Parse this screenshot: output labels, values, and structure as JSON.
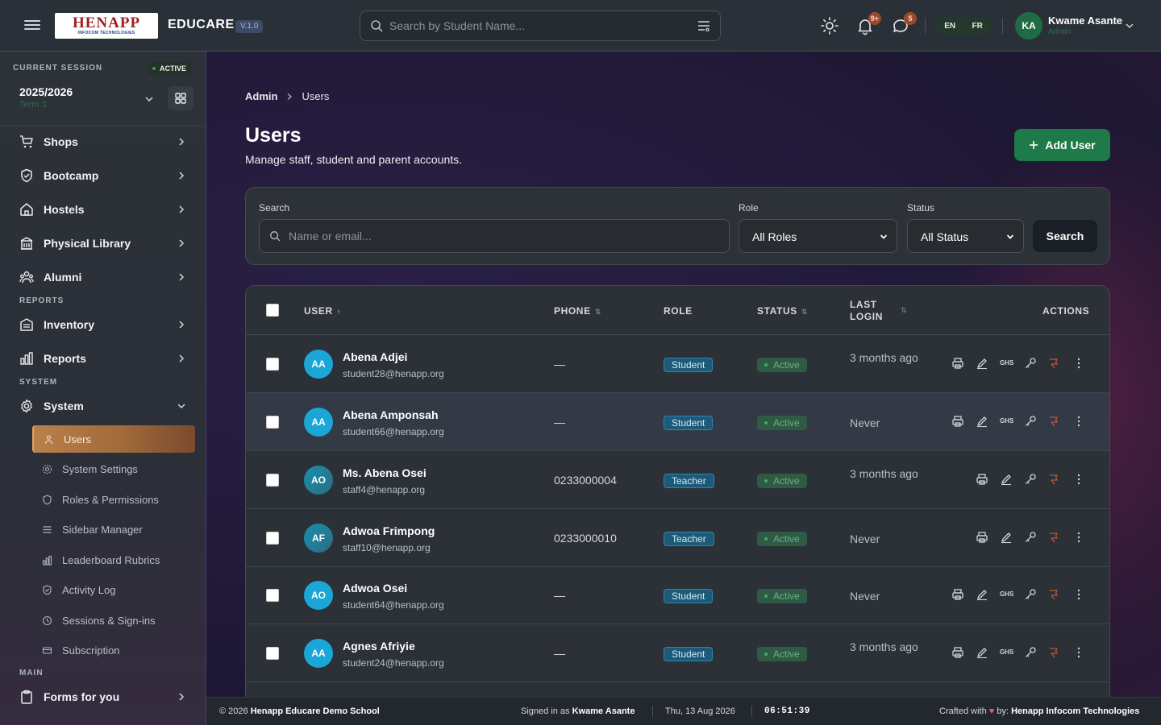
{
  "header": {
    "logo_text": "HENAPP",
    "logo_subtext": "INFOCOM TECHNOLOGIES",
    "app_name": "EDUCARE",
    "version": "V.1.0",
    "search_placeholder": "Search by Student Name...",
    "notifications_count": "9+",
    "messages_count": "5",
    "lang_en": "EN",
    "lang_fr": "FR",
    "user_initials": "KA",
    "user_name": "Kwame Asante",
    "user_role": "Admin"
  },
  "sidebar": {
    "session_label": "CURRENT SESSION",
    "session_status": "ACTIVE",
    "session_year": "2025/2026",
    "session_term": "Term 3",
    "items": [
      {
        "label": "Shops"
      },
      {
        "label": "Bootcamp"
      },
      {
        "label": "Hostels"
      },
      {
        "label": "Physical Library"
      },
      {
        "label": "Alumni"
      }
    ],
    "section_reports": "REPORTS",
    "reports_items": [
      {
        "label": "Inventory"
      },
      {
        "label": "Reports"
      }
    ],
    "section_system": "SYSTEM",
    "system_label": "System",
    "system_sub": [
      {
        "label": "Users"
      },
      {
        "label": "System Settings"
      },
      {
        "label": "Roles & Permissions"
      },
      {
        "label": "Sidebar Manager"
      },
      {
        "label": "Leaderboard Rubrics"
      },
      {
        "label": "Activity Log"
      },
      {
        "label": "Sessions & Sign-ins"
      },
      {
        "label": "Subscription"
      }
    ],
    "section_main": "MAIN",
    "main_items": [
      {
        "label": "Forms for you"
      }
    ]
  },
  "page": {
    "breadcrumb_root": "Admin",
    "breadcrumb_current": "Users",
    "title": "Users",
    "subtitle": "Manage staff, student and parent accounts.",
    "add_button": "Add User"
  },
  "filters": {
    "search_label": "Search",
    "search_placeholder": "Name or email...",
    "role_label": "Role",
    "role_value": "All Roles",
    "status_label": "Status",
    "status_value": "All Status",
    "search_button": "Search"
  },
  "table": {
    "headers": {
      "user": "USER",
      "phone": "PHONE",
      "role": "ROLE",
      "status": "STATUS",
      "last_login_1": "LAST",
      "last_login_2": "LOGIN",
      "actions": "ACTIONS"
    },
    "rows": [
      {
        "initials": "AA",
        "name": "Abena Adjei",
        "email": "student28@henapp.org",
        "phone": "—",
        "role": "Student",
        "status": "Active",
        "last_login": "3 months ago"
      },
      {
        "initials": "AA",
        "name": "Abena Amponsah",
        "email": "student66@henapp.org",
        "phone": "—",
        "role": "Student",
        "status": "Active",
        "last_login": "Never"
      },
      {
        "initials": "AO",
        "name": "Ms. Abena Osei",
        "email": "staff4@henapp.org",
        "phone": "0233000004",
        "role": "Teacher",
        "status": "Active",
        "last_login": "3 months ago"
      },
      {
        "initials": "AF",
        "name": "Adwoa Frimpong",
        "email": "staff10@henapp.org",
        "phone": "0233000010",
        "role": "Teacher",
        "status": "Active",
        "last_login": "Never"
      },
      {
        "initials": "AO",
        "name": "Adwoa Osei",
        "email": "student64@henapp.org",
        "phone": "—",
        "role": "Student",
        "status": "Active",
        "last_login": "Never"
      },
      {
        "initials": "AA",
        "name": "Agnes Afriyie",
        "email": "student24@henapp.org",
        "phone": "—",
        "role": "Student",
        "status": "Active",
        "last_login": "3 months ago"
      }
    ],
    "ghs_label": "GHS"
  },
  "footer": {
    "copyright_prefix": "© 2026",
    "school": "Henapp Educare Demo School",
    "signed_in_prefix": "Signed in as",
    "signed_in_user": "Kwame Asante",
    "date": "Thu, 13 Aug 2026",
    "time": "06:51:39",
    "crafted_prefix": "Crafted with",
    "crafted_by": "by:",
    "company": "Henapp Infocom Technologies"
  },
  "colors": {
    "accent_green": "#1e7a49",
    "active_nav": "#b9804a",
    "student_badge": "#1d5a77",
    "status_active": "#2f5a43"
  }
}
